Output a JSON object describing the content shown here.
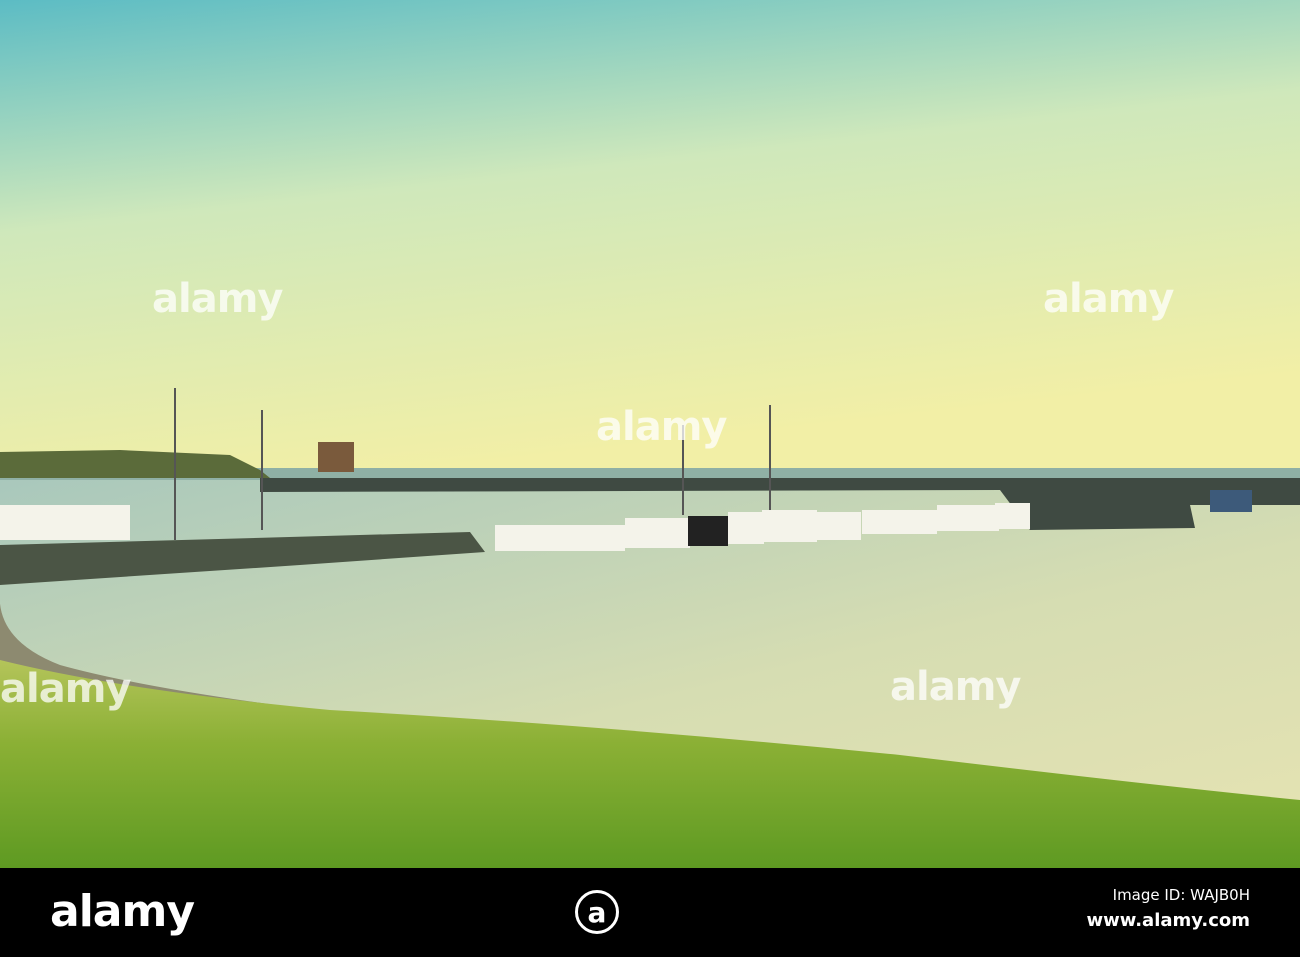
{
  "photo": {
    "subject": "Harbour with fishing boats at sunset",
    "colors": {
      "sky_top": "#6cc6c4",
      "sky_mid": "#dcecb4",
      "sky_low": "#f3f1a8",
      "water": "#c9d7b0",
      "grass": "#7ea62a",
      "rocks": "#4a5347"
    }
  },
  "watermark": {
    "text": "alamy"
  },
  "footer": {
    "logo": "alamy",
    "logo_mark": "a",
    "image_id": "Image ID: WAJB0H",
    "url": "www.alamy.com"
  }
}
